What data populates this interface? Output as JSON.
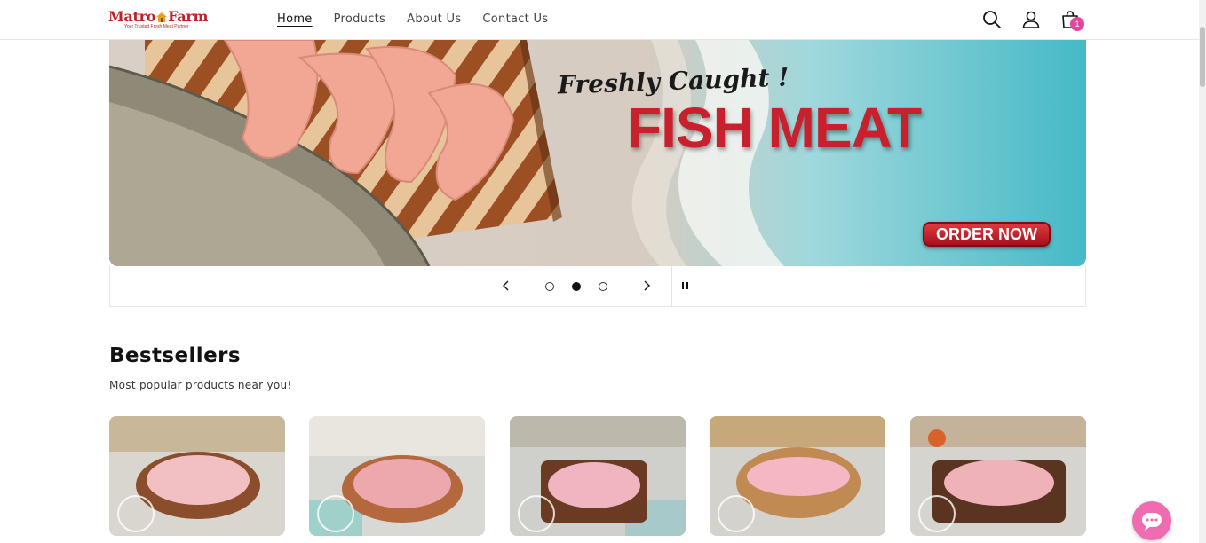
{
  "header": {
    "logo_text_1": "Matro",
    "logo_text_2": "Farm",
    "logo_tagline": "Your Trusted Fresh Meat Partner",
    "nav": [
      {
        "label": "Home",
        "active": true
      },
      {
        "label": "Products",
        "active": false
      },
      {
        "label": "About Us",
        "active": false
      },
      {
        "label": "Contact Us",
        "active": false
      }
    ],
    "icons": [
      "search-icon",
      "account-icon",
      "cart-icon"
    ],
    "cart_count": "1",
    "accent_color": "#e0479a"
  },
  "banner": {
    "script_text": "Freshly Caught !",
    "title": "FISH MEAT",
    "button_label": "ORDER NOW",
    "title_color": "#c8202c"
  },
  "slider": {
    "slide_count": 3,
    "active_slide": 2,
    "icons": [
      "chevron-left-icon",
      "chevron-right-icon",
      "pause-icon"
    ]
  },
  "bestsellers": {
    "title": "Bestsellers",
    "subtitle": "Most popular products near you!",
    "card_count": 5
  },
  "chat": {
    "icon": "chat-icon",
    "color": "#f06cb0"
  }
}
